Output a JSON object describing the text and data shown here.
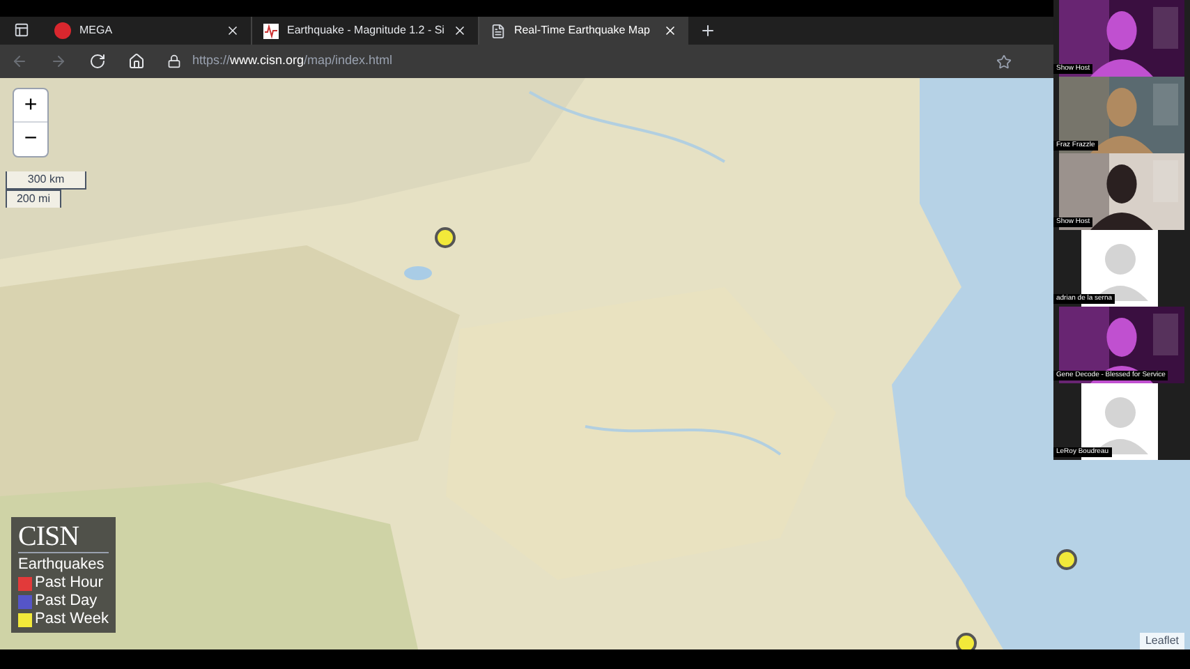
{
  "tabs": [
    {
      "kind": "mega",
      "title": "MEGA",
      "selected": false
    },
    {
      "kind": "chart",
      "title": "Earthquake - Magnitude 1.2 - Si",
      "selected": false
    },
    {
      "kind": "page",
      "title": "Real-Time Earthquake Map",
      "selected": true
    }
  ],
  "address": {
    "url": "https://**www.cisn.org**/map/index.html"
  },
  "map": {
    "zoom_in": "+",
    "zoom_out": "−",
    "scale": [
      "300 km",
      "200 mi"
    ],
    "markers": [
      {
        "color": "#f2e93a"
      },
      {
        "color": "#f2e93a"
      },
      {
        "color": "#f2e93a"
      }
    ],
    "legend": {
      "logo": "CISN",
      "title": "Earthquakes",
      "items": [
        {
          "label": "Past Hour",
          "color": "#e23a3a"
        },
        {
          "label": "Past Day",
          "color": "#5555c8"
        },
        {
          "label": "Past Week",
          "color": "#f2e93a"
        }
      ]
    },
    "attribution": "Leaflet"
  },
  "participants": [
    {
      "name": "Show Host",
      "kind": "video"
    },
    {
      "name": "Fraz Frazzle",
      "kind": "video"
    },
    {
      "name": "Show Host",
      "kind": "video"
    },
    {
      "name": "adrian de la serna",
      "kind": "avatar"
    },
    {
      "name": "Gene Decode - Blessed for Service",
      "kind": "video"
    },
    {
      "name": "LeRoy Boudreau",
      "kind": "avatar"
    }
  ]
}
